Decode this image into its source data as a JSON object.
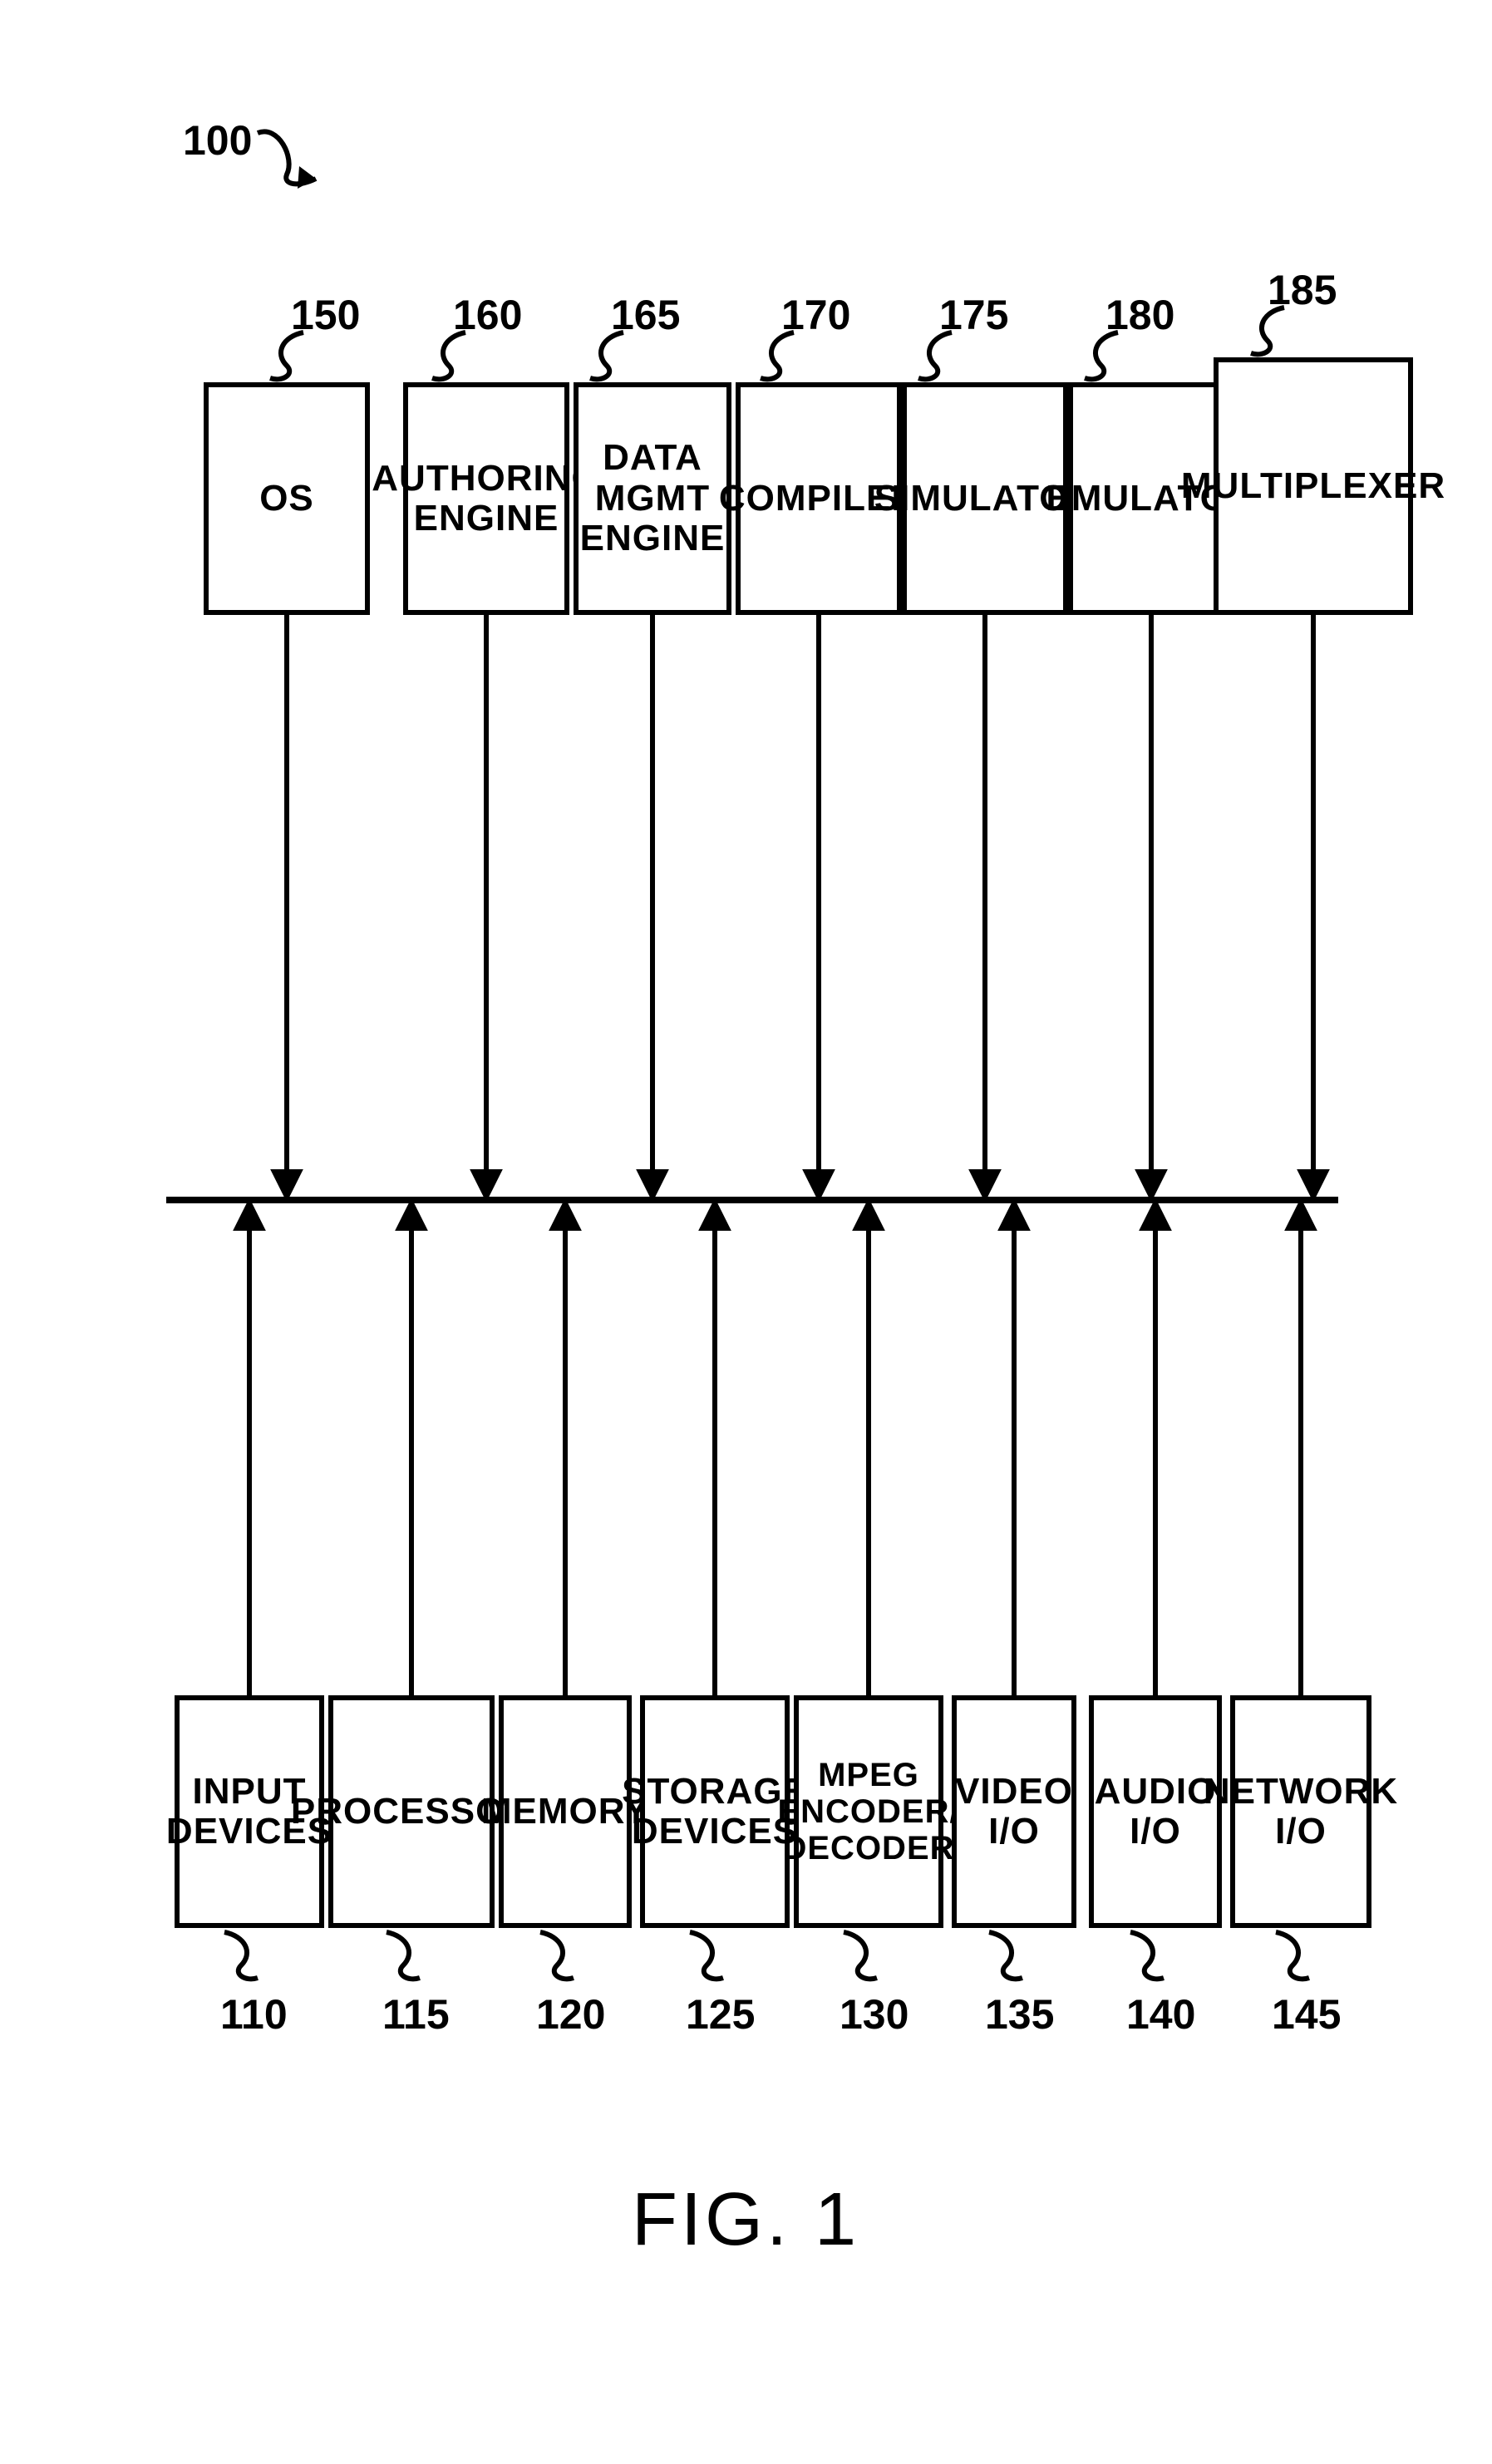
{
  "figure_label": "FIG. 1",
  "system_ref": "100",
  "top_row": [
    {
      "ref": "150",
      "label": "OS"
    },
    {
      "ref": "160",
      "label": "AUTHORING\nENGINE"
    },
    {
      "ref": "165",
      "label": "DATA\nMGMT\nENGINE"
    },
    {
      "ref": "170",
      "label": "COMPILER"
    },
    {
      "ref": "175",
      "label": "SIMULATOR"
    },
    {
      "ref": "180",
      "label": "EMULATOR"
    },
    {
      "ref": "185",
      "label": "MULTIPLEXER"
    }
  ],
  "bottom_row": [
    {
      "ref": "110",
      "label": "INPUT\nDEVICES"
    },
    {
      "ref": "115",
      "label": "PROCESSOR"
    },
    {
      "ref": "120",
      "label": "MEMORY"
    },
    {
      "ref": "125",
      "label": "STORAGE\nDEVICES"
    },
    {
      "ref": "130",
      "label": "MPEG\nENCODER/\nDECODER"
    },
    {
      "ref": "135",
      "label": "VIDEO\nI/O"
    },
    {
      "ref": "140",
      "label": "AUDIO\nI/O"
    },
    {
      "ref": "145",
      "label": "NETWORK\nI/O"
    }
  ]
}
